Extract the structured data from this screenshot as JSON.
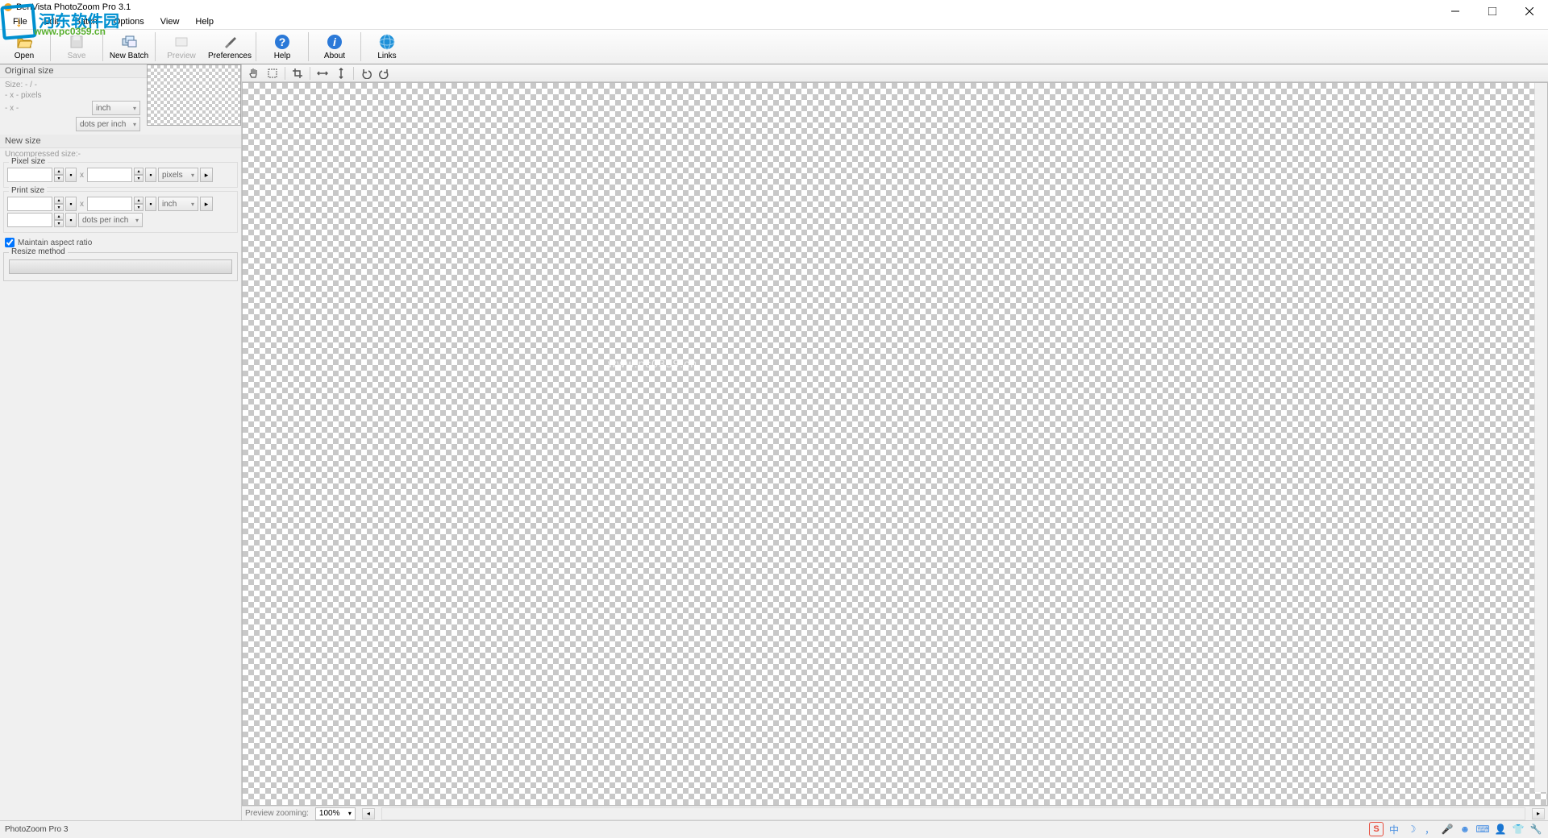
{
  "title": "BenVista PhotoZoom Pro 3.1",
  "watermark": {
    "logo_inner": "↓",
    "text1": "河东软件园",
    "text2": "www.pc0359.cn"
  },
  "menubar": [
    "File",
    "Edit",
    "Batch",
    "Options",
    "View",
    "Help"
  ],
  "toolbar": [
    {
      "name": "open",
      "label": "Open",
      "enabled": true
    },
    {
      "name": "save",
      "label": "Save",
      "enabled": false
    },
    {
      "name": "new-batch",
      "label": "New Batch",
      "enabled": true
    },
    {
      "name": "preview",
      "label": "Preview",
      "enabled": false
    },
    {
      "name": "preferences",
      "label": "Preferences",
      "enabled": true
    },
    {
      "name": "help",
      "label": "Help",
      "enabled": true
    },
    {
      "name": "about",
      "label": "About",
      "enabled": true
    },
    {
      "name": "links",
      "label": "Links",
      "enabled": true
    }
  ],
  "left_panel": {
    "original_header": "Original size",
    "size_line": "Size: - / -",
    "dim_line": "- x - pixels",
    "print_dim": "- x -",
    "unit_inch": "inch",
    "unit_dpi": "dots per inch",
    "new_header": "New size",
    "uncompressed": "Uncompressed size:-",
    "pixel_size_label": "Pixel size",
    "print_size_label": "Print size",
    "pixels_unit": "pixels",
    "maintain_aspect": "Maintain aspect ratio",
    "resize_method_label": "Resize method"
  },
  "canvas_toolbar": {
    "tools": [
      "hand",
      "navigate",
      "crop",
      "flip-h",
      "flip-v",
      "undo",
      "redo"
    ]
  },
  "preview_bar": {
    "label": "Preview zooming:",
    "value": "100%"
  },
  "statusbar": {
    "text": "PhotoZoom Pro 3"
  },
  "tray": {
    "ime": "中"
  }
}
